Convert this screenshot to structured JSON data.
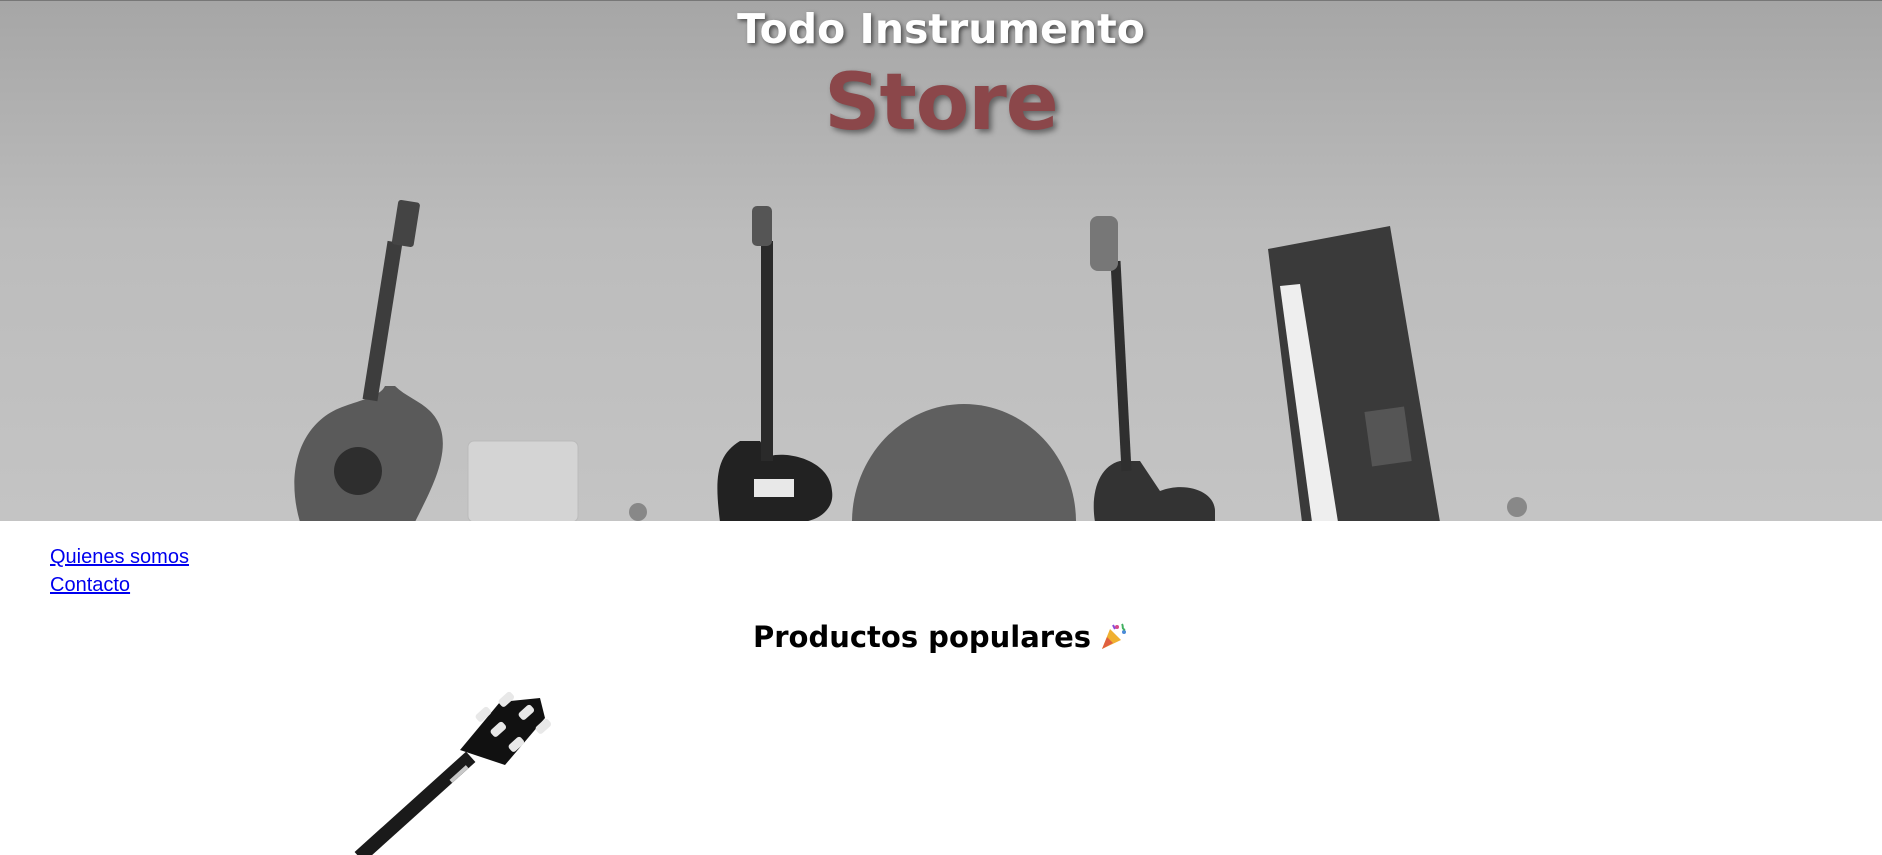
{
  "hero": {
    "title": "Todo Instrumento",
    "subtitle": "Store",
    "subtitle_color": "#8b474a"
  },
  "nav": {
    "items": [
      {
        "label": "Quienes somos"
      },
      {
        "label": "Contacto"
      }
    ]
  },
  "popular": {
    "title": "Productos populares",
    "icon": "party-popper-icon",
    "product_image": "classical-guitar-icon"
  },
  "colors": {
    "link": "#0000ee",
    "hero_bg": "#b5b5b5"
  }
}
